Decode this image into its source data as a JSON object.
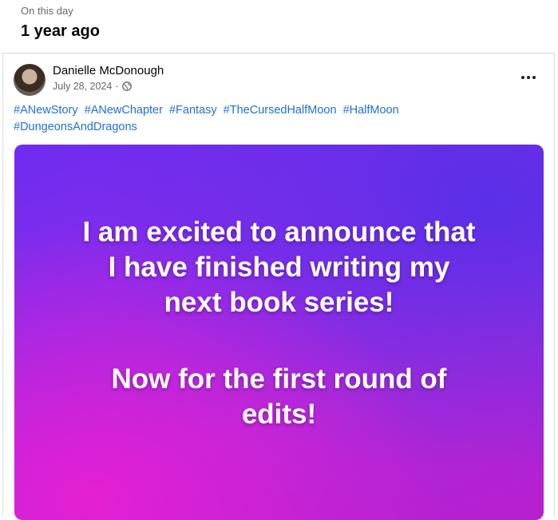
{
  "memory": {
    "kicker": "On this day",
    "title": "1 year ago"
  },
  "post": {
    "author": "Danielle McDonough",
    "date": "July 28, 2024",
    "separator": "·",
    "audience_icon": "globe-icon",
    "more_icon": "more-options-icon",
    "hashtags": [
      "#ANewStory",
      "#ANewChapter",
      "#Fantasy",
      "#TheCursedHalfMoon",
      "#HalfMoon",
      "#DungeonsAndDragons"
    ],
    "image_text": {
      "lines_1": [
        "I am excited to announce that",
        "I have finished writing my",
        "next book series!"
      ],
      "lines_2": [
        "Now for the first round of",
        "edits!"
      ]
    }
  },
  "colors": {
    "hashtag": "#216fdb",
    "meta": "#65676b",
    "image_gradient": [
      "#6d2cf0",
      "#a82ad8",
      "#e51fd4"
    ]
  }
}
